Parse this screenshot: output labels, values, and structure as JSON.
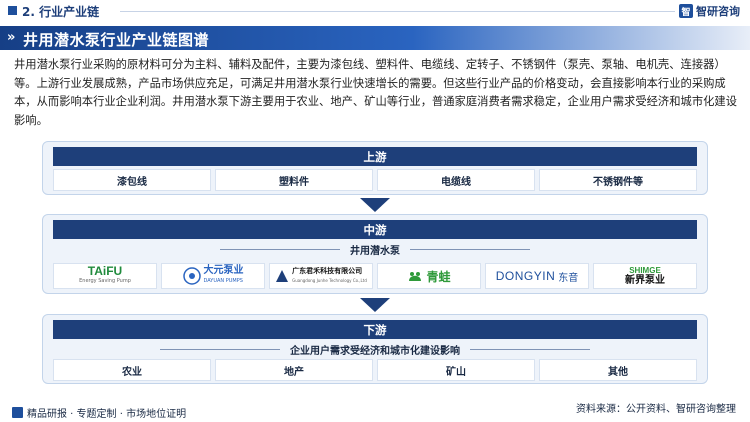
{
  "header": {
    "section": "2. 行业产业链",
    "logo_mark": "智",
    "logo_text": "智研咨询"
  },
  "title": "井用潜水泵行业产业链图谱",
  "intro": "井用潜水泵行业采购的原材料可分为主料、辅料及配件，主要为漆包线、塑料件、电缆线、定转子、不锈钢件（泵壳、泵轴、电机壳、连接器）等。上游行业发展成熟，产品市场供应充足，可满足井用潜水泵行业快速增长的需要。但这些行业产品的价格变动，会直接影响本行业的采购成本，从而影响本行业企业利润。井用潜水泵下游主要用于农业、地产、矿山等行业，普通家庭消费者需求稳定，企业用户需求受经济和城市化建设影响。",
  "upstream": {
    "label": "上游",
    "items": [
      "漆包线",
      "塑料件",
      "电缆线",
      "不锈钢件等"
    ]
  },
  "midstream": {
    "label": "中游",
    "sub": "井用潜水泵",
    "companies": [
      {
        "name": "TAiFU",
        "caption": "Energy Saving Pump"
      },
      {
        "name": "大元泵业",
        "caption": "DAYUAN PUMPS"
      },
      {
        "name": "广东君禾科技有限公司",
        "caption": "Guangdong Junhe Technology Co.,Ltd"
      },
      {
        "name": "青蛙"
      },
      {
        "name": "DONGYIN",
        "caption": "东音"
      },
      {
        "name": "SHIMGE",
        "caption": "新界泵业"
      }
    ]
  },
  "downstream": {
    "label": "下游",
    "sub": "企业用户需求受经济和城市化建设影响",
    "items": [
      "农业",
      "地产",
      "矿山",
      "其他"
    ]
  },
  "footer": {
    "left": "精品研报 · 专题定制 · 市场地位证明",
    "right": "资料来源：公开资料、智研咨询整理"
  },
  "colors": {
    "primary": "#1e3f7a",
    "accent": "#2a64c0",
    "green": "#2f9a3a"
  }
}
